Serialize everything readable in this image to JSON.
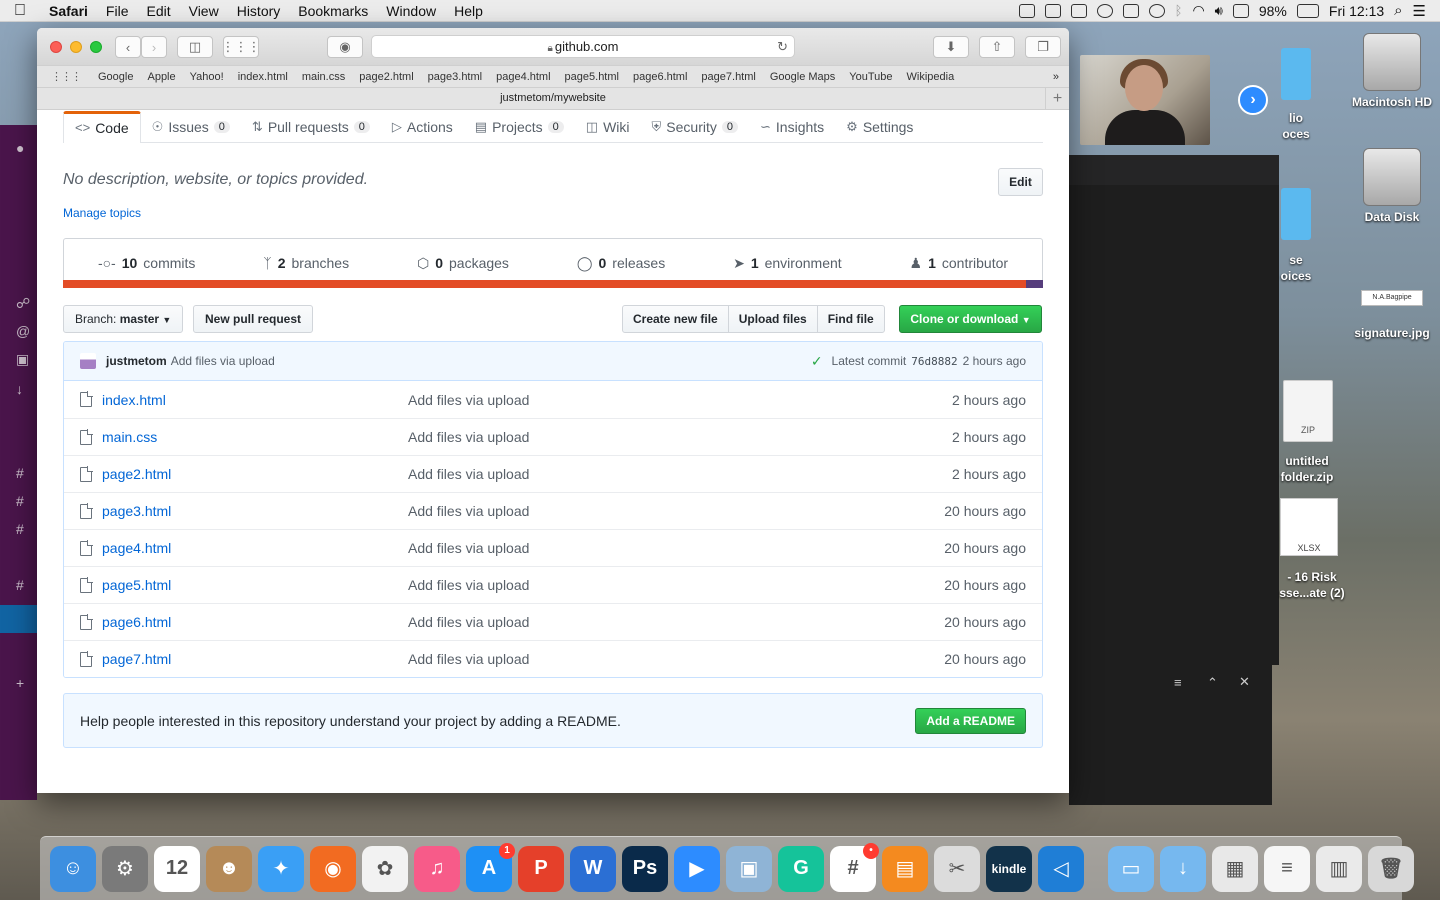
{
  "menubar": {
    "app": "Safari",
    "menus": [
      "File",
      "Edit",
      "View",
      "History",
      "Bookmarks",
      "Window",
      "Help"
    ],
    "battery": "98%",
    "clock": "Fri 12:13"
  },
  "desktop": {
    "icons": [
      "Macintosh HD",
      "Data Disk",
      "signature.jpg",
      "untitled folder.zip",
      "- 16 Risk sse...ate (2)"
    ],
    "partial_labels": [
      "lio\noces",
      "se\noices"
    ],
    "signature_preview": "N.A.Bagpipe",
    "zip_tag": "ZIP",
    "xlsx_tag": "XLSX"
  },
  "safari": {
    "url": "github.com",
    "favorites": [
      "Google",
      "Apple",
      "Yahoo!",
      "index.html",
      "main.css",
      "page2.html",
      "page3.html",
      "page4.html",
      "page5.html",
      "page6.html",
      "page7.html",
      "Google Maps",
      "YouTube",
      "Wikipedia"
    ],
    "tab_title": "justmetom/mywebsite"
  },
  "repo": {
    "nav": [
      {
        "label": "Code",
        "icon": "code-icon",
        "count": null,
        "selected": true
      },
      {
        "label": "Issues",
        "icon": "issue-icon",
        "count": "0"
      },
      {
        "label": "Pull requests",
        "icon": "pull-request-icon",
        "count": "0"
      },
      {
        "label": "Actions",
        "icon": "play-icon",
        "count": null
      },
      {
        "label": "Projects",
        "icon": "project-icon",
        "count": "0"
      },
      {
        "label": "Wiki",
        "icon": "book-icon",
        "count": null
      },
      {
        "label": "Security",
        "icon": "shield-icon",
        "count": "0"
      },
      {
        "label": "Insights",
        "icon": "graph-icon",
        "count": null
      },
      {
        "label": "Settings",
        "icon": "gear-icon",
        "count": null
      }
    ],
    "description": "No description, website, or topics provided.",
    "manage_topics": "Manage topics",
    "edit_label": "Edit",
    "summary": [
      {
        "num": "10",
        "label": "commits",
        "icon": "commit-icon"
      },
      {
        "num": "2",
        "label": "branches",
        "icon": "branch-icon"
      },
      {
        "num": "0",
        "label": "packages",
        "icon": "package-icon"
      },
      {
        "num": "0",
        "label": "releases",
        "icon": "tag-icon"
      },
      {
        "num": "1",
        "label": "environment",
        "icon": "rocket-icon"
      },
      {
        "num": "1",
        "label": "contributor",
        "icon": "people-icon"
      }
    ],
    "language_colors": {
      "html": "#e34c26",
      "css": "#563d7c"
    },
    "branch_prefix": "Branch:",
    "branch_name": "master",
    "new_pull_request": "New pull request",
    "file_buttons": [
      "Create new file",
      "Upload files",
      "Find file"
    ],
    "clone_label": "Clone or download",
    "latest_commit": {
      "user": "justmetom",
      "message": "Add files via upload",
      "prefix": "Latest commit",
      "sha": "76d8882",
      "age": "2 hours ago"
    },
    "files": [
      {
        "name": "index.html",
        "message": "Add files via upload",
        "age": "2 hours ago"
      },
      {
        "name": "main.css",
        "message": "Add files via upload",
        "age": "2 hours ago"
      },
      {
        "name": "page2.html",
        "message": "Add files via upload",
        "age": "2 hours ago"
      },
      {
        "name": "page3.html",
        "message": "Add files via upload",
        "age": "20 hours ago"
      },
      {
        "name": "page4.html",
        "message": "Add files via upload",
        "age": "20 hours ago"
      },
      {
        "name": "page5.html",
        "message": "Add files via upload",
        "age": "20 hours ago"
      },
      {
        "name": "page6.html",
        "message": "Add files via upload",
        "age": "20 hours ago"
      },
      {
        "name": "page7.html",
        "message": "Add files via upload",
        "age": "20 hours ago"
      }
    ],
    "readme_prompt": "Help people interested in this repository understand your project by adding a README.",
    "readme_button": "Add a README"
  },
  "dock": {
    "apps": [
      {
        "name": "finder-icon",
        "color": "#3d8fe0",
        "glyph": "☺"
      },
      {
        "name": "system-preferences-icon",
        "color": "#7a7a7a",
        "glyph": "⚙"
      },
      {
        "name": "calendar-icon",
        "color": "#ffffff",
        "glyph": "12"
      },
      {
        "name": "contacts-icon",
        "color": "#b58a58",
        "glyph": "☻"
      },
      {
        "name": "safari-icon",
        "color": "#3a9ff5",
        "glyph": "✦"
      },
      {
        "name": "firefox-icon",
        "color": "#f26b21",
        "glyph": "◉"
      },
      {
        "name": "photos-icon",
        "color": "#f2f2f2",
        "glyph": "✿"
      },
      {
        "name": "itunes-icon",
        "color": "#f75b89",
        "glyph": "♫"
      },
      {
        "name": "app-store-icon",
        "color": "#1e90f5",
        "glyph": "A",
        "badge": "1"
      },
      {
        "name": "wps-presentation-icon",
        "color": "#e5402a",
        "glyph": "P"
      },
      {
        "name": "word-icon",
        "color": "#2b6fd4",
        "glyph": "W"
      },
      {
        "name": "photoshop-icon",
        "color": "#0a2a4a",
        "glyph": "Ps"
      },
      {
        "name": "zoom-icon",
        "color": "#2d8cff",
        "glyph": "▶"
      },
      {
        "name": "preview-icon",
        "color": "#8fb4d6",
        "glyph": "▣"
      },
      {
        "name": "grammarly-icon",
        "color": "#15c39a",
        "glyph": "G"
      },
      {
        "name": "slack-icon",
        "color": "#ffffff",
        "glyph": "#",
        "badge": "•"
      },
      {
        "name": "ibooks-icon",
        "color": "#f48a1f",
        "glyph": "▤"
      },
      {
        "name": "scissors-icon",
        "color": "#dcdcdc",
        "glyph": "✂"
      },
      {
        "name": "kindle-icon",
        "color": "#12324a",
        "glyph": "kindle"
      },
      {
        "name": "vscode-icon",
        "color": "#1f7ed6",
        "glyph": "◁"
      }
    ],
    "stack": [
      {
        "name": "applications-folder-icon",
        "color": "#76b8ef",
        "glyph": "▭"
      },
      {
        "name": "downloads-folder-icon",
        "color": "#76b8ef",
        "glyph": "↓"
      },
      {
        "name": "screenshot-stack-icon",
        "color": "#e8e8e8",
        "glyph": "▦"
      },
      {
        "name": "document-stack-icon",
        "color": "#f6f6f6",
        "glyph": "≡"
      },
      {
        "name": "zoom-document-icon",
        "color": "#eaeaea",
        "glyph": "▥"
      },
      {
        "name": "trash-icon",
        "color": "#d8d8d8",
        "glyph": "🗑"
      }
    ]
  }
}
